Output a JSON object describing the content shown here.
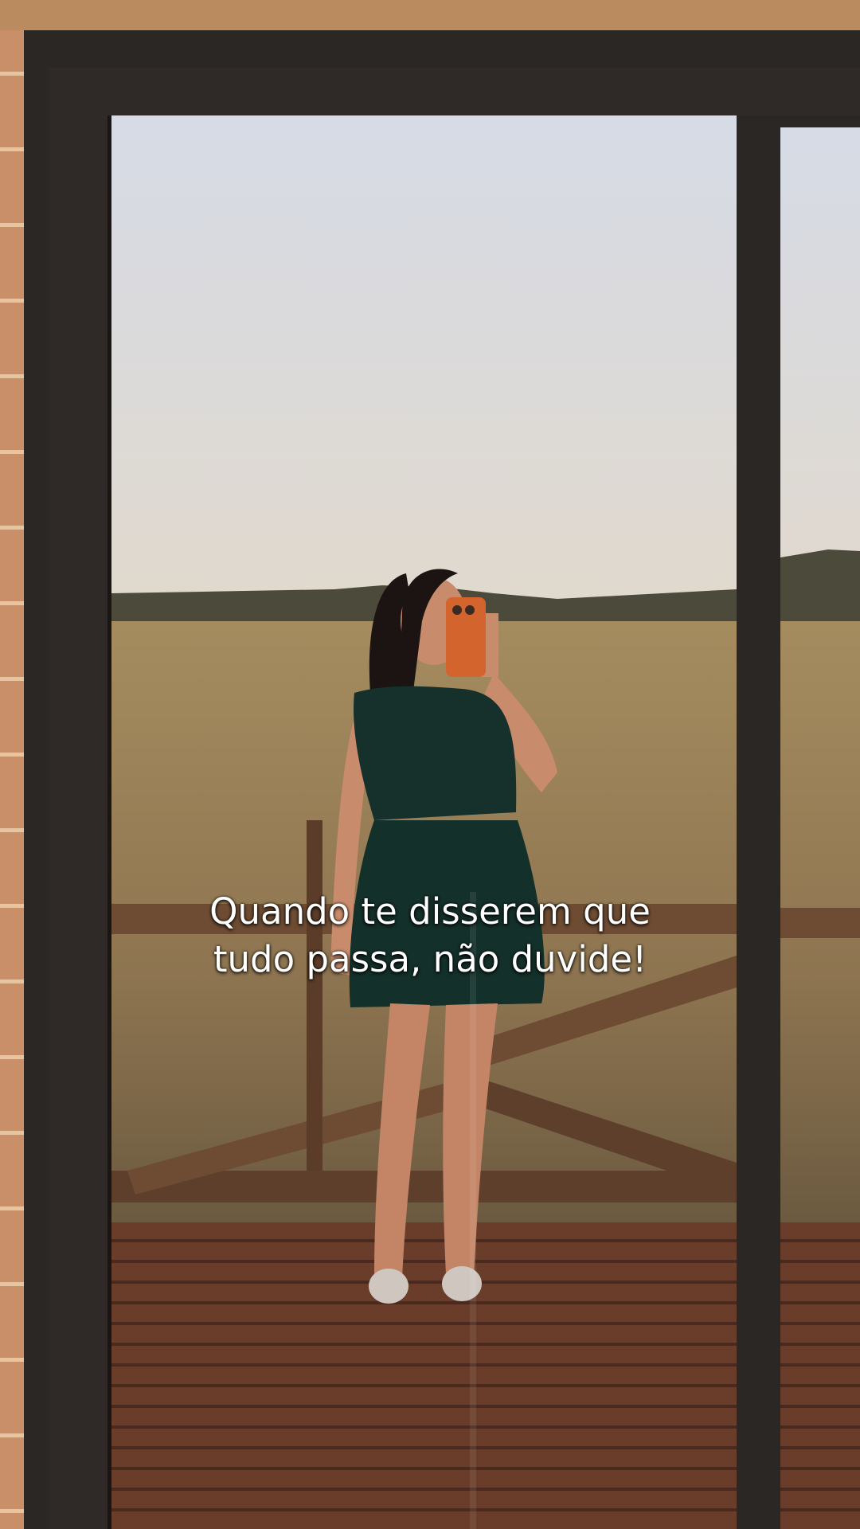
{
  "caption": {
    "line1": "Quando te disserem que",
    "line2": "tudo passa, não duvide!"
  },
  "colors": {
    "sky_top": "#d6dbe6",
    "sky_mid": "#e6d2b8",
    "sky_horizon": "#f3b35a",
    "field": "#9c8455",
    "deck": "#6a3c2a",
    "frame": "#2b2725",
    "brick": "#c98f68",
    "dress": "#16302b",
    "phone_case": "#d4642d",
    "skin": "#c88b6b",
    "hair": "#1b1412"
  }
}
